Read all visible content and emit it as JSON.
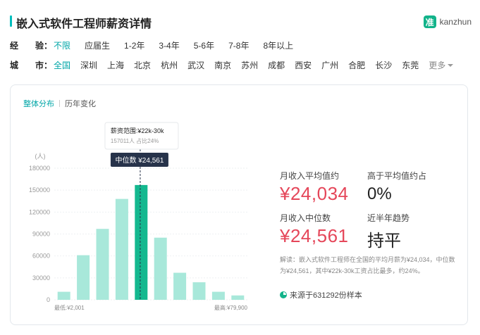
{
  "header": {
    "title": "嵌入式软件工程师薪资详情",
    "brand_icon": "准",
    "brand_text": "kanzhun"
  },
  "filters": {
    "experience": {
      "label": "经　　验：",
      "options": [
        "不限",
        "应届生",
        "1-2年",
        "3-4年",
        "5-6年",
        "7-8年",
        "8年以上"
      ],
      "active": 0
    },
    "city": {
      "label": "城　　市：",
      "options": [
        "全国",
        "深圳",
        "上海",
        "北京",
        "杭州",
        "武汉",
        "南京",
        "苏州",
        "成都",
        "西安",
        "广州",
        "合肥",
        "长沙",
        "东莞"
      ],
      "active": 0,
      "more": "更多"
    }
  },
  "tabs": {
    "overall": "整体分布",
    "history": "历年变化"
  },
  "chart_data": {
    "type": "bar",
    "ylabel": "(人)",
    "yticks": [
      0,
      30000,
      60000,
      90000,
      120000,
      150000,
      180000
    ],
    "ylim": [
      0,
      180000
    ],
    "values": [
      11000,
      61000,
      97000,
      138000,
      157011,
      85000,
      37000,
      24000,
      11000,
      6000
    ],
    "highlight_index": 4,
    "x_min_label": "最低:¥2,001",
    "x_max_label": "最高:¥79,900",
    "tooltip": {
      "range": "薪资范围:¥22k-30k",
      "detail": "157011人  占比24%"
    },
    "median_label": "中位数 ¥24,561",
    "median_position": 0.445,
    "colors": {
      "bar": "#a8e8da",
      "highlight": "#14b88f",
      "median_box": "#27334a"
    }
  },
  "stats": {
    "avg_label": "月收入平均值约",
    "avg_value": "¥24,034",
    "above_label": "高于平均值约占",
    "above_value": "0%",
    "median_label": "月收入中位数",
    "median_value": "¥24,561",
    "trend_label": "近半年趋势",
    "trend_value": "持平"
  },
  "note": "解读：嵌入式软件工程师在全国的平均月薪为¥24,034，中位数为¥24,561，其中¥22k-30k工资占比最多，约24%。",
  "source": "来源于631292份样本"
}
